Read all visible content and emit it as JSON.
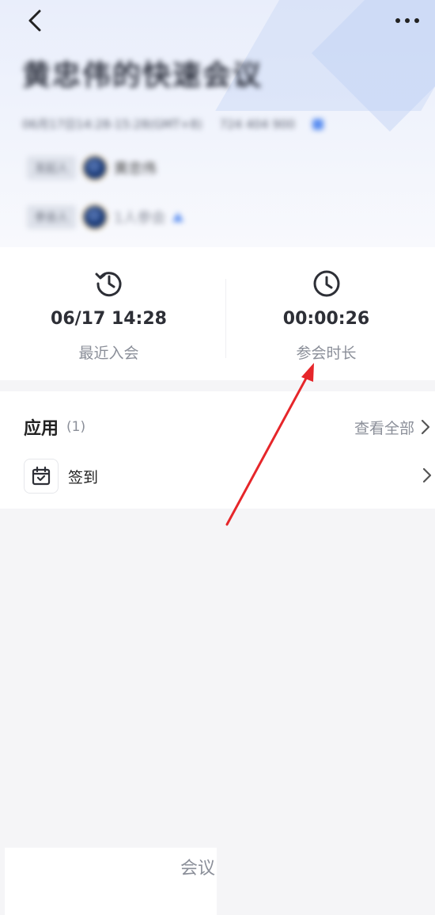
{
  "header": {
    "back_icon": "chevron-left-icon",
    "more_icon": "more-dots-icon",
    "meeting_title": "黄忠伟的快速会议",
    "meeting_time": "06月17日14:28-15:28(GMT+8)",
    "meeting_id": "724 404 900",
    "participants": [
      {
        "role": "发起人",
        "name": "黄忠伟"
      },
      {
        "role": "参会人",
        "name": "1人参会"
      }
    ]
  },
  "stats": {
    "recent_join": {
      "value": "06/17 14:28",
      "label": "最近入会",
      "icon": "history-clock-icon"
    },
    "duration": {
      "value": "00:00:26",
      "label": "参会时长",
      "icon": "clock-icon"
    }
  },
  "apps": {
    "title": "应用",
    "count": "(1)",
    "view_all": "查看全部",
    "items": [
      {
        "name": "签到",
        "icon": "calendar-check-icon"
      }
    ]
  },
  "bottom": {
    "tab_label": "会议"
  },
  "colors": {
    "annotation_arrow": "#e6262a",
    "accent_blue": "#5b8ef0"
  }
}
